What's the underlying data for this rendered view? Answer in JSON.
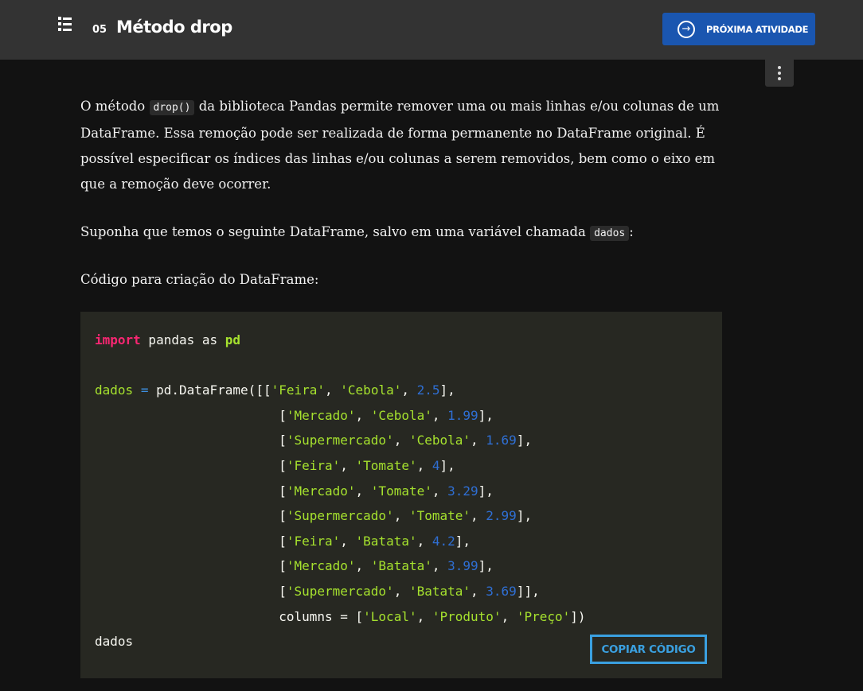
{
  "header": {
    "lesson_number": "05",
    "title": "Método drop",
    "next_button_label": "PRÓXIMA ATIVIDADE",
    "next_button_color": "#1a56b0"
  },
  "icons": {
    "menu": "list-icon",
    "next": "arrow-right-circle-icon",
    "more": "more-vertical-icon"
  },
  "content": {
    "p1_before": "O método ",
    "p1_code": "drop()",
    "p1_after": " da biblioteca Pandas permite remover uma ou mais linhas e/ou colunas de um DataFrame. Essa remoção pode ser realizada de forma permanente no DataFrame original. É possível especificar os índices das linhas e/ou colunas a serem removidos, bem como o eixo em que a remoção deve ocorrer.",
    "p2_before": "Suponha que temos o seguinte DataFrame, salvo em uma variável chamada ",
    "p2_code": "dados",
    "p2_after": ":",
    "p3": "Código para criação do DataFrame:"
  },
  "code_block": {
    "import_kw": "import",
    "import_rest": " pandas as ",
    "import_alias": "pd",
    "rows": [
      {
        "s1": "Feira",
        "s2": "Cebola",
        "n": "2.5"
      },
      {
        "s1": "Mercado",
        "s2": "Cebola",
        "n": "1.99"
      },
      {
        "s1": "Supermercado",
        "s2": "Cebola",
        "n": "1.69"
      },
      {
        "s1": "Feira",
        "s2": "Tomate",
        "n": "4"
      },
      {
        "s1": "Mercado",
        "s2": "Tomate",
        "n": "3.29"
      },
      {
        "s1": "Supermercado",
        "s2": "Tomate",
        "n": "2.99"
      },
      {
        "s1": "Feira",
        "s2": "Batata",
        "n": "4.2"
      },
      {
        "s1": "Mercado",
        "s2": "Batata",
        "n": "3.99"
      },
      {
        "s1": "Supermercado",
        "s2": "Batata",
        "n": "3.69"
      }
    ],
    "columns": [
      "Local",
      "Produto",
      "Preço"
    ],
    "last_line": "dados",
    "copy_button_label": "COPIAR CÓDIGO"
  }
}
